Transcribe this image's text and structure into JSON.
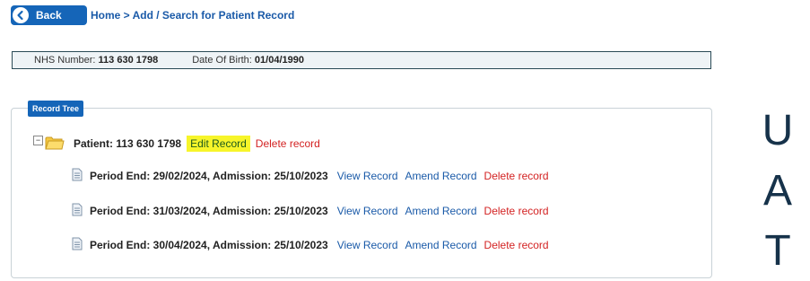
{
  "nav": {
    "back_label": "Back",
    "breadcrumb_home": "Home",
    "breadcrumb_sep": " > ",
    "breadcrumb_current": "Add / Search for Patient Record"
  },
  "patient_bar": {
    "nhs_label": "NHS Number: ",
    "nhs_value": "113 630 1798",
    "dob_label": "Date Of Birth: ",
    "dob_value": "01/04/1990"
  },
  "record_tree": {
    "title": "Record Tree",
    "toggle": "−",
    "patient_label": "Patient: 113 630 1798",
    "edit_label": "Edit Record",
    "delete_label": "Delete record",
    "periods": [
      {
        "label": "Period End: 29/02/2024, Admission: 25/10/2023",
        "view": "View Record",
        "amend": "Amend Record",
        "delete": "Delete record"
      },
      {
        "label": "Period End: 31/03/2024, Admission: 25/10/2023",
        "view": "View Record",
        "amend": "Amend Record",
        "delete": "Delete record"
      },
      {
        "label": "Period End: 30/04/2024, Admission: 25/10/2023",
        "view": "View Record",
        "amend": "Amend Record",
        "delete": "Delete record"
      }
    ]
  },
  "watermark": {
    "letter1": "U",
    "letter2": "A",
    "letter3": "T"
  },
  "colors": {
    "primary": "#1565b8",
    "link": "#1a5aa8",
    "delete": "#d32222",
    "highlight": "#f7f52a"
  }
}
